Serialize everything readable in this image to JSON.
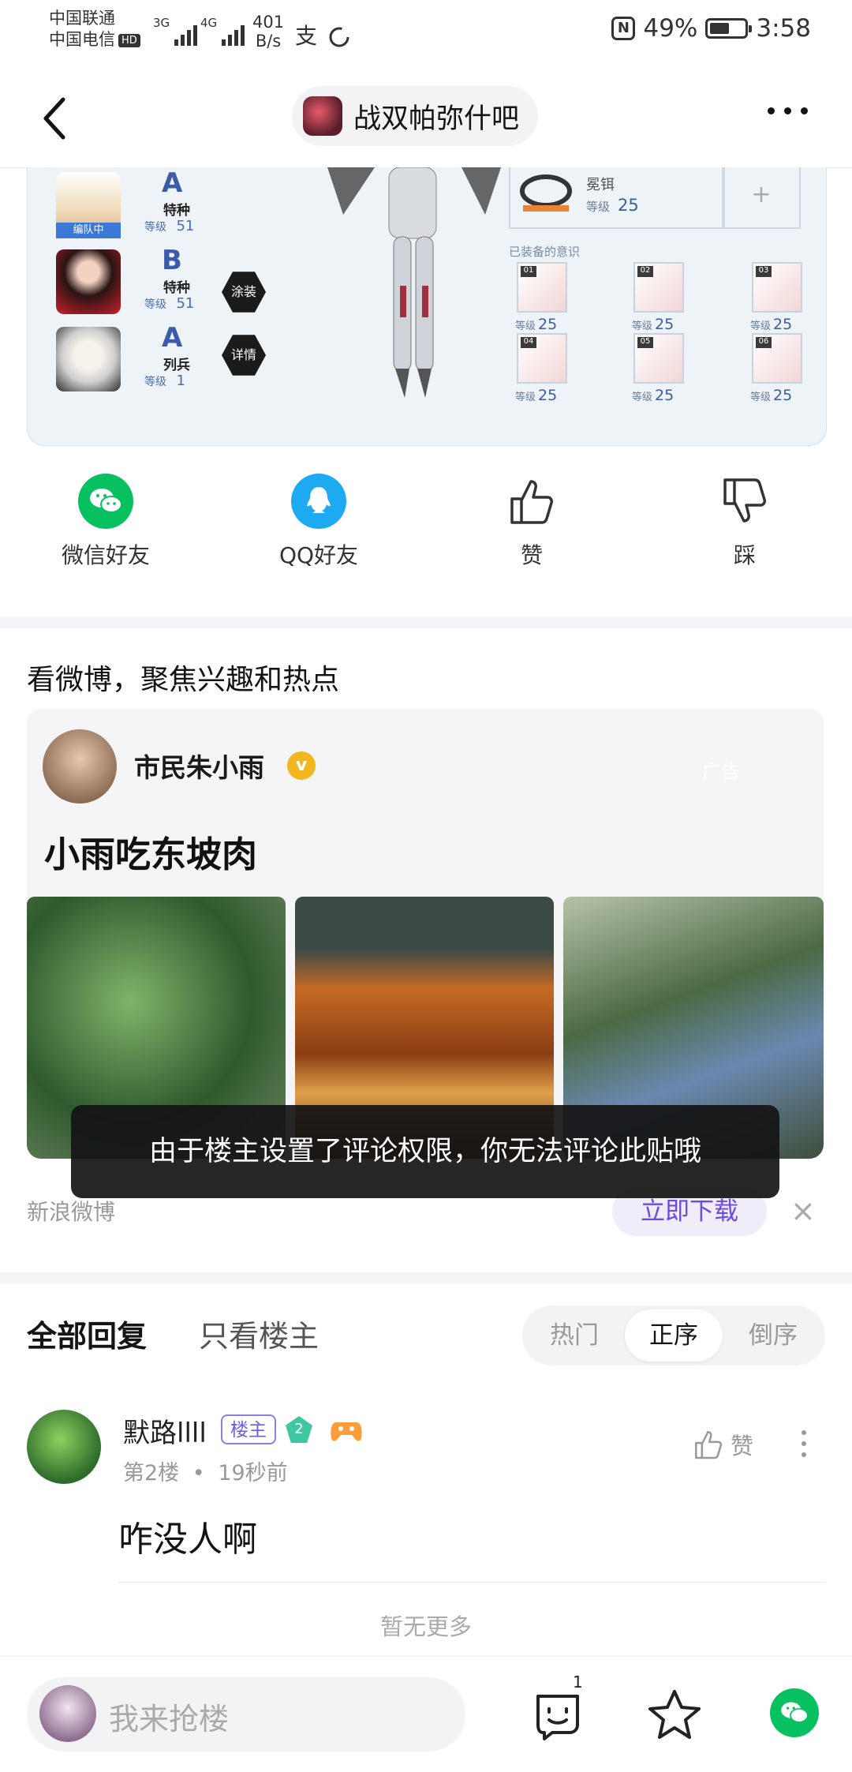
{
  "status_bar": {
    "carrier1": "中国联通",
    "carrier2": "中国电信",
    "hd": "HD",
    "net1": "3G",
    "net2": "4G",
    "speed_value": "401",
    "speed_unit": "B/s",
    "alipay_glyph": "支",
    "nfc": "N",
    "battery": "49%",
    "battery_level": 0.49,
    "time": "3:58"
  },
  "nav": {
    "forum_name": "战双帕弥什吧"
  },
  "post_image": {
    "characters": [
      {
        "grade": "A",
        "role": "特种",
        "level_label": "等级",
        "level": "51",
        "tag": "编队中"
      },
      {
        "grade": "B",
        "role": "特种",
        "level_label": "等级",
        "level": "51"
      },
      {
        "grade": "A",
        "role": "列兵",
        "level_label": "等级",
        "level": "1"
      }
    ],
    "buttons": {
      "paint": "涂装",
      "detail": "详情"
    },
    "equip": {
      "name": "冕铒",
      "level_label": "等级",
      "level": "25"
    },
    "memory_title": "已装备的意识",
    "memories": [
      {
        "num": "01",
        "level_label": "等级",
        "level": "25"
      },
      {
        "num": "02",
        "level_label": "等级",
        "level": "25"
      },
      {
        "num": "03",
        "level_label": "等级",
        "level": "25"
      },
      {
        "num": "04",
        "level_label": "等级",
        "level": "25"
      },
      {
        "num": "05",
        "level_label": "等级",
        "level": "25"
      },
      {
        "num": "06",
        "level_label": "等级",
        "level": "25"
      }
    ]
  },
  "share": {
    "wechat": "微信好友",
    "qq": "QQ好友",
    "like": "赞",
    "dislike": "踩"
  },
  "ad": {
    "title": "看微博，聚焦兴趣和热点",
    "user": "市民朱小雨",
    "verified": "v",
    "headline": "小雨吃东坡肉",
    "tag": "广告",
    "source": "新浪微博",
    "download": "立即下载",
    "close": "×"
  },
  "toast": "由于楼主设置了评论权限，你无法评论此贴哦",
  "tabs": {
    "all": "全部回复",
    "owner_only": "只看楼主",
    "sort": [
      "热门",
      "正序",
      "倒序"
    ],
    "sort_selected": "正序"
  },
  "comment": {
    "user": "默路llll",
    "owner_badge": "楼主",
    "level": "2",
    "floor": "第2楼",
    "dot": "•",
    "time": "19秒前",
    "like_label": "赞",
    "text": "咋没人啊"
  },
  "no_more": "暂无更多",
  "bottom_bar": {
    "placeholder": "我来抢楼",
    "emoji_count": "1"
  },
  "colors": {
    "accent": "#6d49e6",
    "wechat_green": "#07c160",
    "qq_blue": "#1eaaf1",
    "separator": "#f4f5f9"
  }
}
